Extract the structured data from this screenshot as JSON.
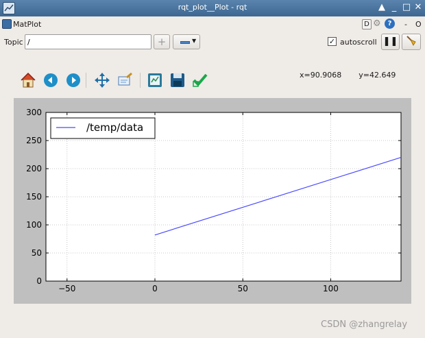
{
  "window": {
    "title": "rqt_plot__Plot - rqt",
    "controls": [
      "▲",
      "_",
      "□",
      "✕"
    ]
  },
  "plugin": {
    "title": "MatPlot",
    "d_label": "D",
    "help_label": "?",
    "minus_label": "-",
    "count_label": "O"
  },
  "topic": {
    "label": "Topic",
    "value": "/",
    "add_label": "+",
    "autoscroll_label": "autoscroll",
    "autoscroll_checked": true,
    "check_mark": "✓"
  },
  "toolbar": {
    "icons": [
      "home-icon",
      "back-icon",
      "forward-icon",
      "pan-icon",
      "zoom-icon",
      "subplots-icon",
      "save-icon",
      "apply-icon"
    ],
    "coords_x": "x=90.9068",
    "coords_y": "y=42.649"
  },
  "chart_data": {
    "type": "line",
    "series": [
      {
        "name": "/temp/data",
        "color": "#4a4aff",
        "x": [
          0,
          140
        ],
        "y": [
          82,
          220
        ]
      }
    ],
    "xlim": [
      -62,
      140
    ],
    "ylim": [
      0,
      300
    ],
    "xticks": [
      -50,
      0,
      50,
      100
    ],
    "yticks": [
      0,
      50,
      100,
      150,
      200,
      250,
      300
    ],
    "xtick_labels": [
      "−50",
      "0",
      "50",
      "100"
    ],
    "ytick_labels": [
      "0",
      "50",
      "100",
      "150",
      "200",
      "250",
      "300"
    ],
    "grid": true,
    "legend_position": "top-left"
  },
  "watermark": "CSDN @zhangrelay"
}
